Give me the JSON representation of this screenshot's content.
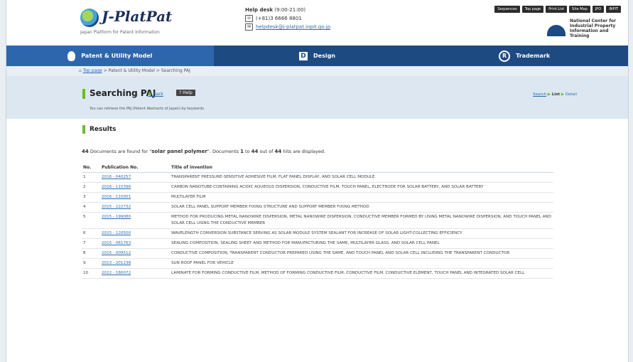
{
  "header": {
    "logo_text": "J-PlatPat",
    "logo_sub": "Japan Platform for Patent Information",
    "helpdesk_title": "Help desk",
    "helpdesk_hours": "(9:00-21:00)",
    "phone": "(+81)3 6666 8801",
    "email": "helpdesk@j-platpat.inpit.go.jp",
    "top_buttons": [
      "Sequences",
      "Top page",
      "Print List",
      "Site Map",
      "JPO",
      "INPIT"
    ],
    "org_name": "National Center for Industrial Property Information and Training"
  },
  "nav": {
    "tabs": [
      {
        "label": "Patent & Utility Model",
        "icon": "bulb-icon",
        "active": true
      },
      {
        "label": "Design",
        "icon": "design-icon",
        "active": false
      },
      {
        "label": "Trademark",
        "icon": "trademark-icon",
        "active": false
      }
    ]
  },
  "breadcrumb": {
    "home": "Top page",
    "sep1": ">",
    "item1": "Patent & Utility Model",
    "sep2": ">",
    "item2": "Searching PAJ"
  },
  "search_band": {
    "title": "Searching PAJ",
    "back": "Back",
    "help": "Help",
    "description": "You can retrieve the PAJ (Patent Abstracts of Japan) by keywords.",
    "steps": [
      "Search",
      "List",
      "Detail"
    ]
  },
  "results": {
    "heading": "Results",
    "count": "44",
    "query": "solar panel polymer",
    "from": "1",
    "to": "44",
    "total": "44",
    "text_found": " Documents are found for ",
    "text_docs": ". Documents ",
    "text_to": " to ",
    "text_outof": " out of ",
    "text_tail": " hits are displayed.",
    "columns": [
      "No.",
      "Publication No.",
      "Title of invention"
    ],
    "rows": [
      {
        "no": "1",
        "pub": "2016 - 040257",
        "title": "TRANSPARENT PRESSURE-SENSITIVE ADHESIVE FILM, FLAT PANEL DISPLAY, AND SOLAR CELL MODULE"
      },
      {
        "no": "2",
        "pub": "2016 - 115396",
        "title": "CARBON NANOTUBE-CONTAINING ACIDIC AQUEOUS DISPERSION, CONDUCTIVE FILM, TOUCH PANEL, ELECTRODE FOR SOLAR BATTERY, AND SOLAR BATTERY"
      },
      {
        "no": "3",
        "pub": "2016 - 110001",
        "title": "MULTILAYER FILM"
      },
      {
        "no": "4",
        "pub": "2015 - 222732",
        "title": "SOLAR CELL PANEL SUPPORT MEMBER FIXING STRUCTURE AND SUPPORT MEMBER FIXING METHOD"
      },
      {
        "no": "5",
        "pub": "2015 - 199080",
        "title": "METHOD FOR PRODUCING METAL NANOWIRE DISPERSION, METAL NANOWIRE DISPERSION, CONDUCTIVE MEMBER FORMED BY USING METAL NANOWIRE DISPERSION, AND TOUCH PANEL AND SOLAR CELL USING THE CONDUCTIVE MEMBER"
      },
      {
        "no": "6",
        "pub": "2015 - 120500",
        "title": "WAVELENGTH CONVERSION SUBSTANCE SERVING AS SOLAR MODULE SYSTEM SEALANT FOR INCREASE OF SOLAR LIGHT-COLLECTING EFFICIENCY"
      },
      {
        "no": "7",
        "pub": "2015 - 061763",
        "title": "SEALING COMPOSITION, SEALING SHEET AND METHOD FOR MANUFACTURING THE SAME, MULTILAYER GLASS, AND SOLAR CELL PANEL"
      },
      {
        "no": "8",
        "pub": "2015 - 009512",
        "title": "CONDUCTIVE COMPOSITION, TRANSPARENT CONDUCTOR PREPARED USING THE SAME, AND TOUCH PANEL AND SOLAR CELL INCLUDING THE TRANSPARENT CONDUCTOR"
      },
      {
        "no": "9",
        "pub": "2013 - 201238",
        "title": "SUN ROOF PANEL FOR VEHICLE"
      },
      {
        "no": "10",
        "pub": "2012 - 180072",
        "title": "LAMINATE FOR FORMING CONDUCTIVE FILM, METHOD OF FORMING CONDUCTIVE FILM, CONDUCTIVE FILM, CONDUCTIVE ELEMENT, TOUCH PANEL AND INTEGRATED SOLAR CELL"
      }
    ]
  }
}
